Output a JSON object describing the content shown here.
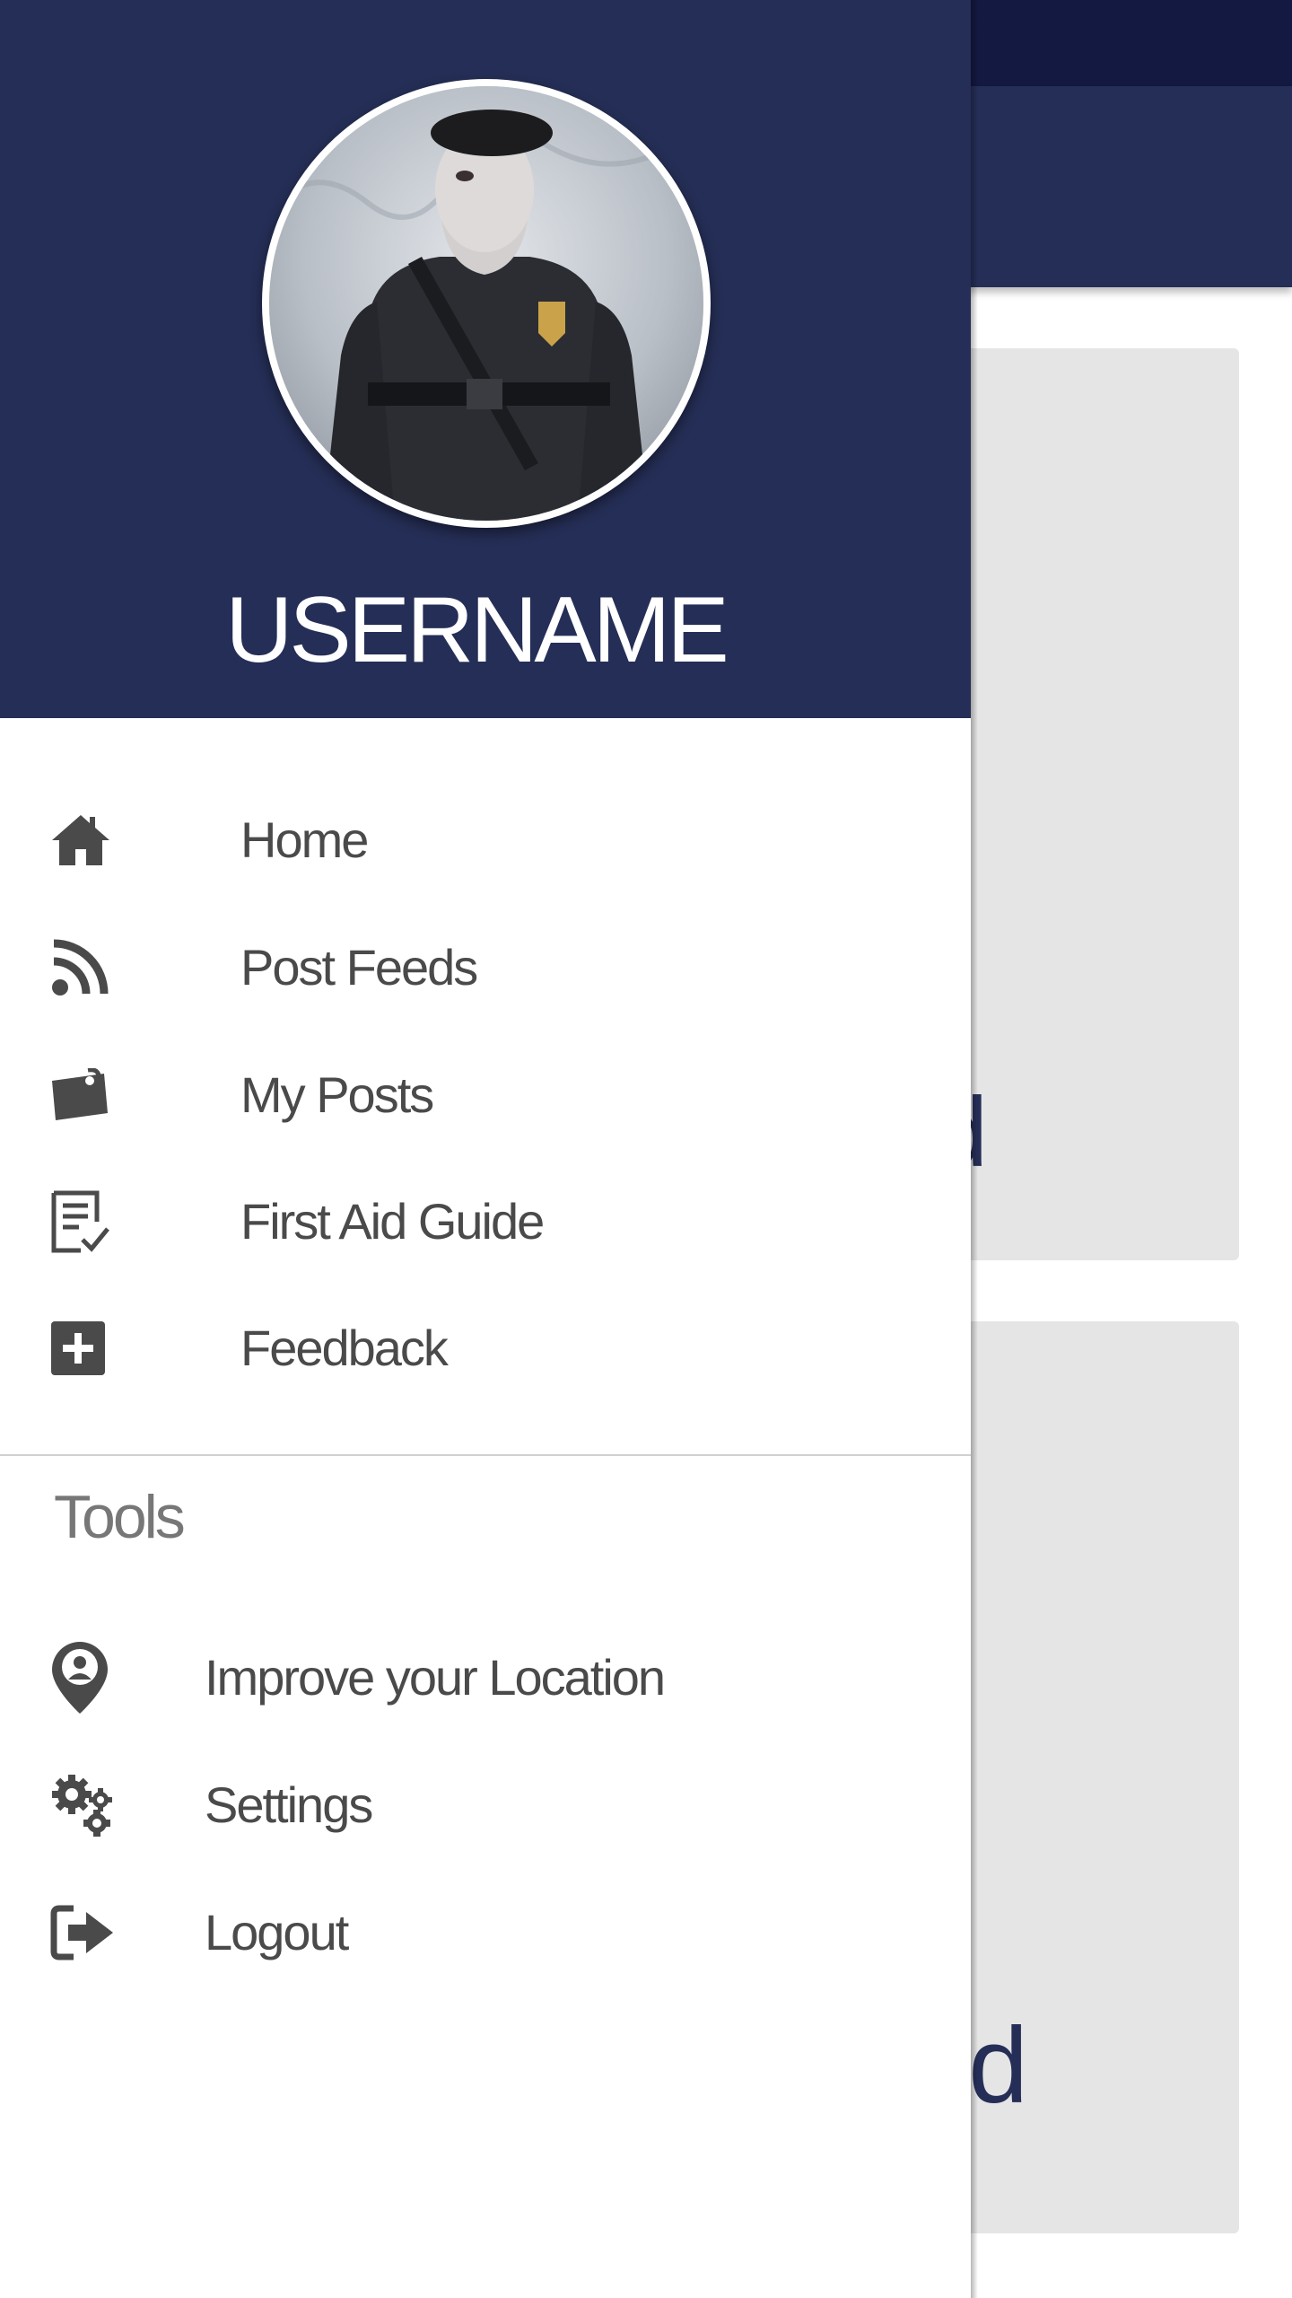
{
  "colors": {
    "primary": "#252e56",
    "status_bar": "#131940",
    "card": "#e5e5e5",
    "menu_text": "#4a4a4a",
    "section_text": "#777777"
  },
  "background": {
    "card1_text": "d",
    "card2_text": "d"
  },
  "drawer": {
    "username": "USERNAME",
    "primary_items": [
      {
        "label": "Home",
        "icon": "home-icon"
      },
      {
        "label": "Post Feeds",
        "icon": "rss-icon"
      },
      {
        "label": "My Posts",
        "icon": "note-icon"
      },
      {
        "label": "First Aid Guide",
        "icon": "checklist-icon"
      },
      {
        "label": "Feedback",
        "icon": "plus-square-icon"
      }
    ],
    "tools_title": "Tools",
    "tools_items": [
      {
        "label": "Improve your Location",
        "icon": "location-pin-icon"
      },
      {
        "label": "Settings",
        "icon": "gears-icon"
      },
      {
        "label": "Logout",
        "icon": "logout-icon"
      }
    ]
  }
}
